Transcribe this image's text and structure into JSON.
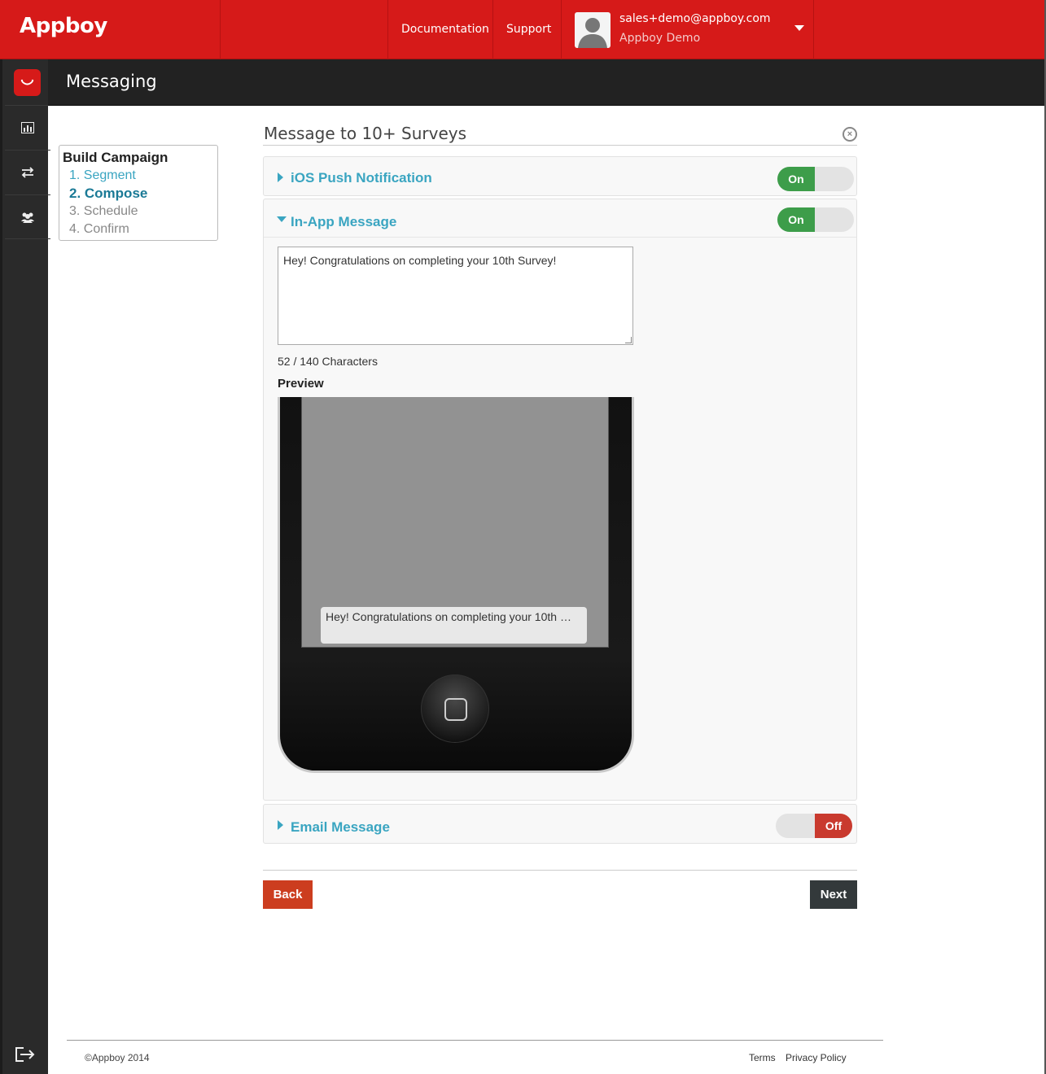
{
  "brand": {
    "name": "Appboy",
    "accent": "#d61a19"
  },
  "topnav": {
    "links": [
      "Documentation",
      "Support"
    ],
    "user_email": "sales+demo@appboy.com",
    "user_org": "Appboy Demo"
  },
  "rail": {
    "icons": [
      "appboy-icon",
      "analytics-icon",
      "messaging-icon",
      "users-icon",
      "logout-icon"
    ]
  },
  "section": {
    "title": "Messaging"
  },
  "steps": {
    "title": "Build Campaign",
    "items": [
      "1. Segment",
      "2. Compose",
      "3. Schedule",
      "4. Confirm"
    ],
    "active_index": 1
  },
  "page": {
    "title": "Message to 10+ Surveys"
  },
  "channels": [
    {
      "name": "iOS Push Notification",
      "state": "On",
      "expanded": false
    },
    {
      "name": "In-App Message",
      "state": "On",
      "expanded": true
    },
    {
      "name": "Email Message",
      "state": "Off",
      "expanded": false
    }
  ],
  "inapp": {
    "message": "Hey! Congratulations on completing your 10th Survey!",
    "char_count": "52 / 140 Characters",
    "preview_label": "Preview",
    "preview_text": "Hey! Congratulations on completing your 10th …"
  },
  "actions": {
    "back": "Back",
    "next": "Next"
  },
  "footer": {
    "copyright": "©Appboy 2014",
    "links": [
      "Terms",
      "Privacy Policy"
    ]
  }
}
